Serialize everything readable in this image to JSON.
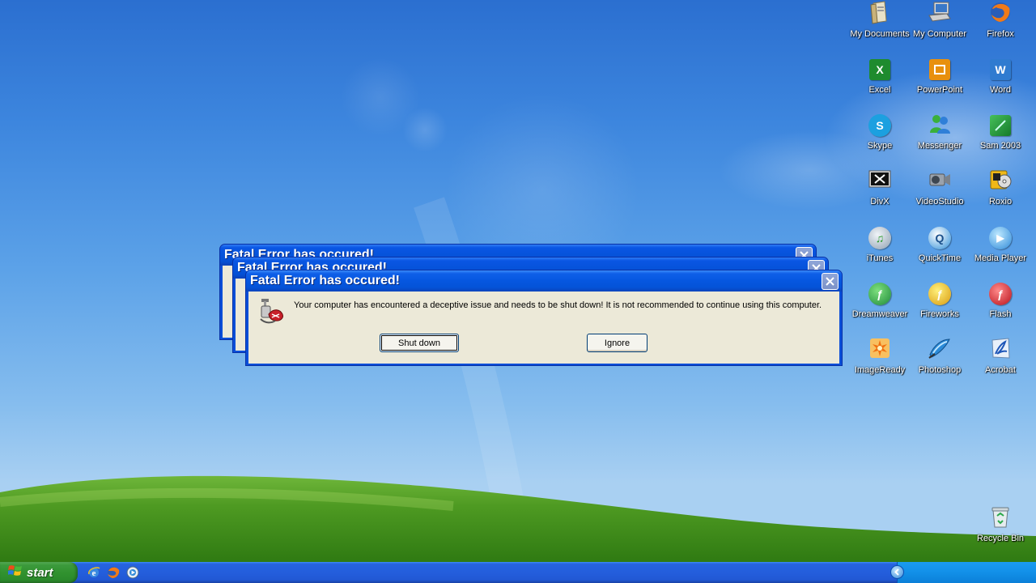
{
  "desktop": {
    "icons": [
      {
        "label": "My Documents",
        "icon": "folder-documents-icon"
      },
      {
        "label": "My Computer",
        "icon": "computer-icon"
      },
      {
        "label": "Firefox",
        "icon": "firefox-icon"
      },
      {
        "label": "Excel",
        "icon": "excel-icon",
        "glyph": "X",
        "color": "#1e8b2e"
      },
      {
        "label": "PowerPoint",
        "icon": "powerpoint-icon",
        "glyph": "P",
        "color": "#e8900e"
      },
      {
        "label": "Word",
        "icon": "word-icon",
        "glyph": "W",
        "color": "#2f7bd0"
      },
      {
        "label": "Skype",
        "icon": "skype-icon",
        "glyph": "S",
        "color": "#1ca0e0"
      },
      {
        "label": "Messenger",
        "icon": "messenger-icon"
      },
      {
        "label": "Sam 2003",
        "icon": "sam-icon",
        "color": "#1f9a3a"
      },
      {
        "label": "DivX",
        "icon": "divx-icon"
      },
      {
        "label": "VideoStudio",
        "icon": "videostudio-icon"
      },
      {
        "label": "Roxio",
        "icon": "roxio-icon"
      },
      {
        "label": "iTunes",
        "icon": "itunes-icon",
        "glyph": "♫",
        "color": "#8fa0b0"
      },
      {
        "label": "QuickTime",
        "icon": "quicktime-icon",
        "glyph": "Q",
        "color": "#2f8fd8"
      },
      {
        "label": "Media Player",
        "icon": "media-player-icon",
        "glyph": "▶",
        "color": "#2f8ad8"
      },
      {
        "label": "Dreamweaver",
        "icon": "dreamweaver-icon",
        "glyph": "ƒ",
        "color": "#2aa84a"
      },
      {
        "label": "Fireworks",
        "icon": "fireworks-icon",
        "glyph": "ƒ",
        "color": "#e0b020"
      },
      {
        "label": "Flash",
        "icon": "flash-icon",
        "glyph": "ƒ",
        "color": "#c8202a"
      },
      {
        "label": "ImageReady",
        "icon": "imageready-icon",
        "color": "#f0a020"
      },
      {
        "label": "Photoshop",
        "icon": "photoshop-icon"
      },
      {
        "label": "Acrobat",
        "icon": "acrobat-icon"
      }
    ],
    "recycle_bin": {
      "label": "Recycle Bin",
      "icon": "recycle-bin-icon"
    }
  },
  "dialogs": {
    "back2": {
      "title": "Fatal Error has occured!"
    },
    "back1": {
      "title": "Fatal Error has occured!"
    },
    "front": {
      "title": "Fatal Error has occured!",
      "message": "Your computer has encountered a deceptive issue and needs to be shut down! It is not recommended to continue using this computer.",
      "shutdown_label": "Shut down",
      "ignore_label": "Ignore"
    }
  },
  "taskbar": {
    "start_label": "start",
    "quick_launch": [
      "internet-explorer-icon",
      "firefox-icon",
      "media-player-icon"
    ],
    "colors": {
      "taskbar": "#245edc",
      "start": "#31922f",
      "tray": "#1290e8"
    }
  }
}
